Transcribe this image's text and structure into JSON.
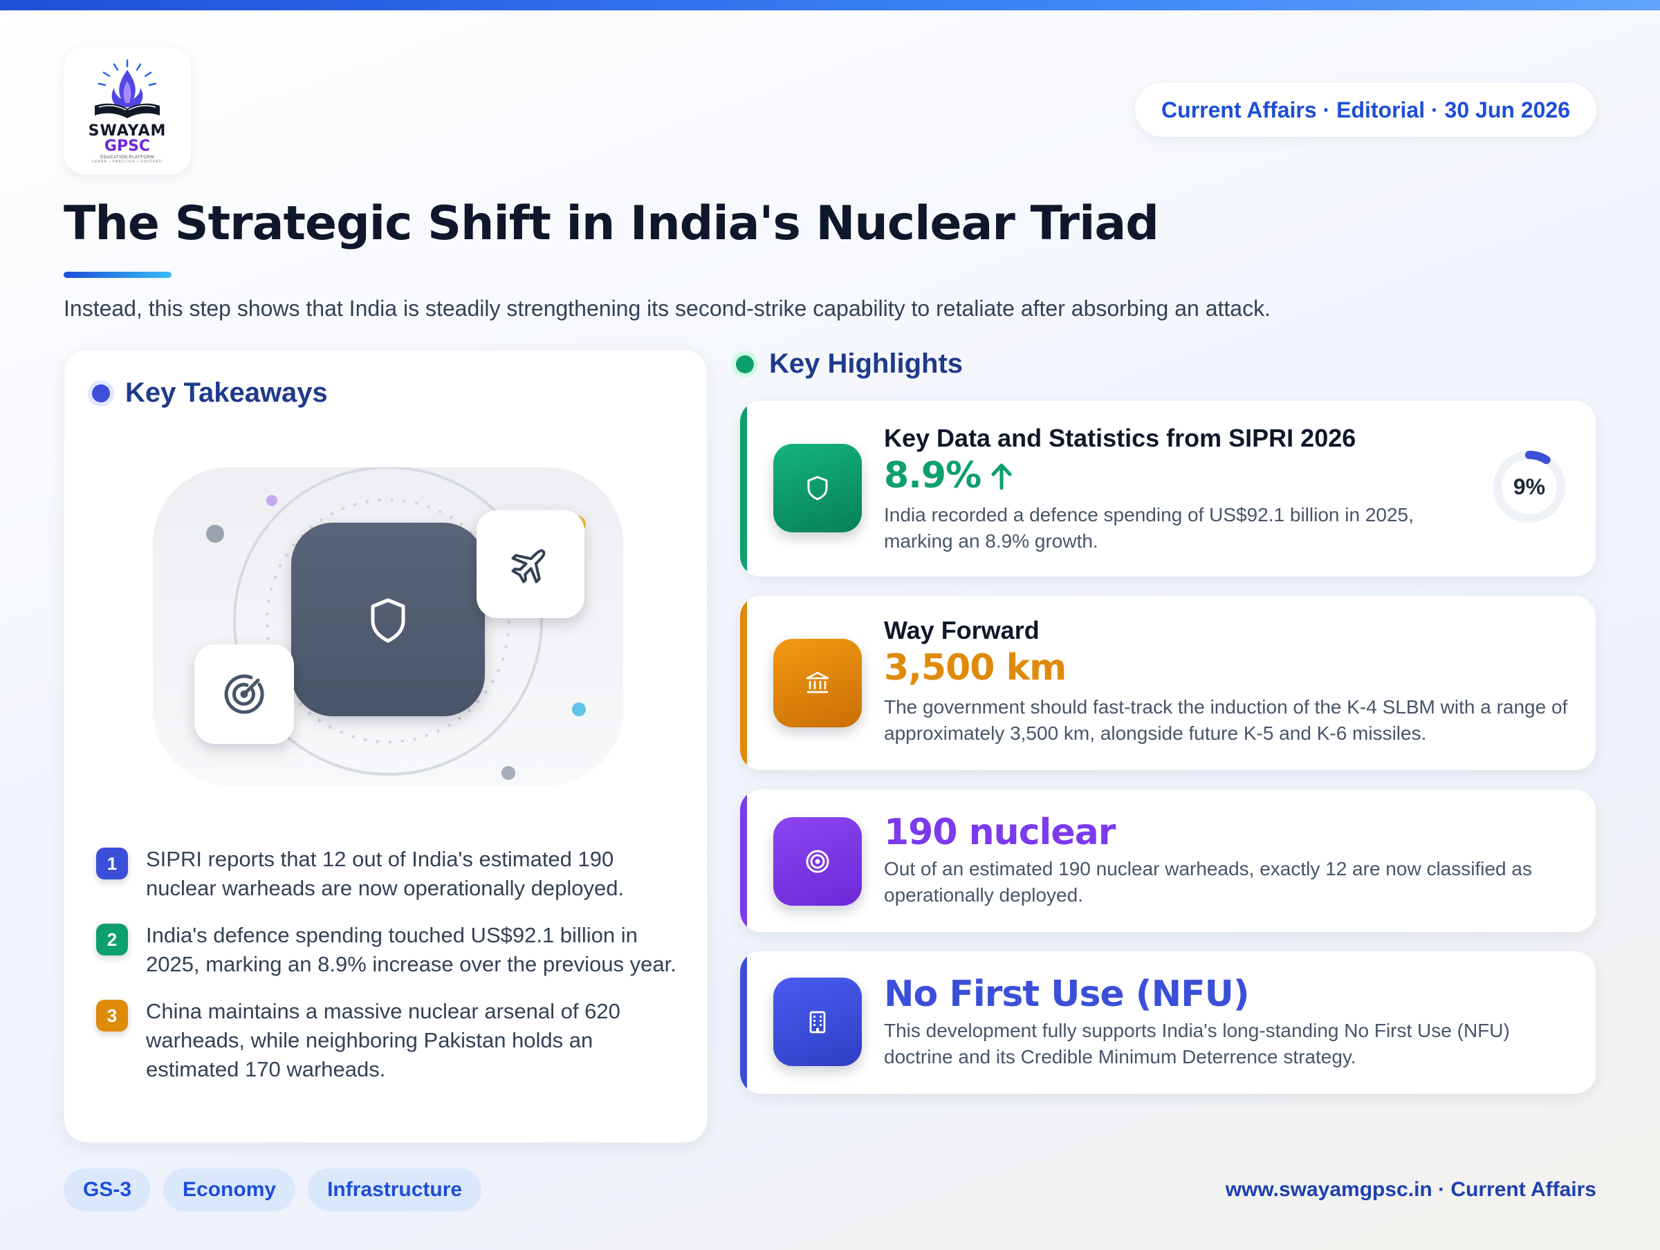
{
  "brand": {
    "logo_line1": "SWAYAM",
    "logo_line2": "GPSC",
    "logo_tagline": "EDUCATION PLATFORM",
    "logo_motto": "LEARN • PRACTICE • SUCCEED"
  },
  "meta_pill": "Current Affairs · Editorial · 30 Jun 2026",
  "title": "The Strategic Shift in India's Nuclear Triad",
  "subtitle": "Instead, this step shows that India is steadily strengthening its second-strike capability to retaliate after absorbing an attack.",
  "takeaways": {
    "heading": "Key Takeaways",
    "illustration_icons": [
      "shield-icon",
      "airplane-icon",
      "radar-icon"
    ],
    "items": [
      {
        "num": "1",
        "text": "SIPRI reports that 12 out of India's estimated 190 nuclear warheads are now operationally deployed.",
        "color": "#3b4fd8"
      },
      {
        "num": "2",
        "text": "India's defence spending touched US$92.1 billion in 2025, marking an 8.9% increase over the previous year.",
        "color": "#0e9f6e"
      },
      {
        "num": "3",
        "text": "China maintains a massive nuclear arsenal of 620 warheads, while neighboring Pakistan holds an estimated 170 warheads.",
        "color": "#e08a0b"
      }
    ]
  },
  "highlights": {
    "heading": "Key Highlights",
    "cards": [
      {
        "title": "Key Data and Statistics from SIPRI 2026",
        "value": "8.9%",
        "trend": "up",
        "desc": "India recorded a defence spending of US$92.1 billion in 2025, marking an 8.9% growth.",
        "ring_label": "9%",
        "ring_fraction": 0.09,
        "icon": "shield-icon",
        "color": "#0e9f6e"
      },
      {
        "title": "Way Forward",
        "value": "3,500 km",
        "desc": "The government should fast-track the induction of the K-4 SLBM with a range of approximately 3,500 km, alongside future K-5 and K-6 missiles.",
        "icon": "bank-icon",
        "color": "#e08a0b"
      },
      {
        "title": "",
        "value": "190 nuclear",
        "desc": "Out of an estimated 190 nuclear warheads, exactly 12 are now classified as operationally deployed.",
        "icon": "target-icon",
        "color": "#7c3aed"
      },
      {
        "title": "",
        "value": "No First Use (NFU)",
        "desc": "This development fully supports India's long-standing No First Use (NFU) doctrine and its Credible Minimum Deterrence strategy.",
        "icon": "building-icon",
        "color": "#3b4fd8"
      }
    ]
  },
  "tags": [
    "GS-3",
    "Economy",
    "Infrastructure"
  ],
  "footer": "www.swayamgpsc.in · Current Affairs",
  "colors": {
    "accent_blue": "#1d4ed8",
    "navy": "#1e3a8a",
    "green": "#0e9f6e",
    "orange": "#e08a0b",
    "purple": "#7c3aed",
    "indigo": "#3b4fd8"
  }
}
